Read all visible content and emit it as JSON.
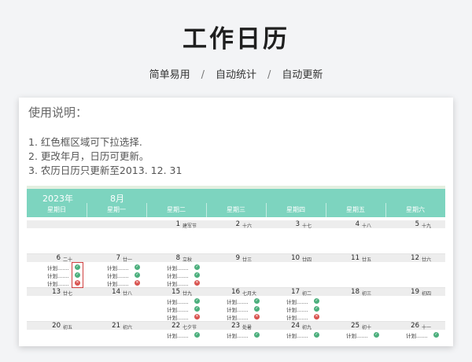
{
  "page": {
    "title": "工作日历",
    "features": [
      "简单易用",
      "自动统计",
      "自动更新"
    ],
    "separator": "/"
  },
  "instructions": {
    "title": "使用说明：",
    "items": [
      "1. 红色框区域可下拉选择.",
      "2. 更改年月，日历可更新。",
      "3. 农历日历只更新至2013. 12. 31"
    ]
  },
  "calendar": {
    "year": "2023年",
    "month": "8月",
    "weekdays": [
      "星期日",
      "星期一",
      "星期二",
      "星期三",
      "星期四",
      "星期五",
      "星期六"
    ],
    "colors": {
      "header": "#7dd4bf",
      "done": "#4caf7d",
      "not_done": "#d9534f",
      "dropdown_border": "#d04040"
    },
    "weeks": [
      {
        "days": [
          {
            "num": "",
            "lunar": "",
            "plans": []
          },
          {
            "num": "",
            "lunar": "",
            "plans": []
          },
          {
            "num": "1",
            "lunar": "建军节",
            "plans": []
          },
          {
            "num": "2",
            "lunar": "十六",
            "plans": []
          },
          {
            "num": "3",
            "lunar": "十七",
            "plans": []
          },
          {
            "num": "4",
            "lunar": "十八",
            "plans": []
          },
          {
            "num": "5",
            "lunar": "十九",
            "plans": []
          }
        ]
      },
      {
        "days": [
          {
            "num": "6",
            "lunar": "二十",
            "plans": [
              {
                "text": "计划.......",
                "status": "done"
              },
              {
                "text": "计划.......",
                "status": "done"
              },
              {
                "text": "计划.......",
                "status": "not_done"
              }
            ]
          },
          {
            "num": "7",
            "lunar": "廿一",
            "plans": [
              {
                "text": "计划.......",
                "status": "done"
              },
              {
                "text": "计划.......",
                "status": "done"
              },
              {
                "text": "计划.......",
                "status": "not_done"
              }
            ]
          },
          {
            "num": "8",
            "lunar": "立秋",
            "plans": [
              {
                "text": "计划.......",
                "status": "done"
              },
              {
                "text": "计划.......",
                "status": "done"
              },
              {
                "text": "计划.......",
                "status": "not_done"
              }
            ]
          },
          {
            "num": "9",
            "lunar": "廿三",
            "plans": []
          },
          {
            "num": "10",
            "lunar": "廿四",
            "plans": []
          },
          {
            "num": "11",
            "lunar": "廿五",
            "plans": []
          },
          {
            "num": "12",
            "lunar": "廿六",
            "plans": []
          }
        ]
      },
      {
        "days": [
          {
            "num": "13",
            "lunar": "廿七",
            "plans": []
          },
          {
            "num": "14",
            "lunar": "廿八",
            "plans": []
          },
          {
            "num": "15",
            "lunar": "廿九",
            "plans": [
              {
                "text": "计划.......",
                "status": "done"
              },
              {
                "text": "计划.......",
                "status": "done"
              },
              {
                "text": "计划.......",
                "status": "not_done"
              }
            ]
          },
          {
            "num": "16",
            "lunar": "七月大",
            "plans": [
              {
                "text": "计划.......",
                "status": "done"
              },
              {
                "text": "计划.......",
                "status": "done"
              },
              {
                "text": "计划.......",
                "status": "not_done"
              }
            ]
          },
          {
            "num": "17",
            "lunar": "初二",
            "plans": [
              {
                "text": "计划.......",
                "status": "done"
              },
              {
                "text": "计划.......",
                "status": "done"
              },
              {
                "text": "计划.......",
                "status": "not_done"
              }
            ]
          },
          {
            "num": "18",
            "lunar": "初三",
            "plans": []
          },
          {
            "num": "19",
            "lunar": "初四",
            "plans": []
          }
        ]
      },
      {
        "days": [
          {
            "num": "20",
            "lunar": "初五",
            "plans": []
          },
          {
            "num": "21",
            "lunar": "初六",
            "plans": []
          },
          {
            "num": "22",
            "lunar": "七夕节",
            "plans": [
              {
                "text": "计划.......",
                "status": "done"
              }
            ]
          },
          {
            "num": "23",
            "lunar": "处暑",
            "plans": [
              {
                "text": "计划.......",
                "status": "done"
              }
            ]
          },
          {
            "num": "24",
            "lunar": "初九",
            "plans": [
              {
                "text": "计划.......",
                "status": "done"
              }
            ]
          },
          {
            "num": "25",
            "lunar": "初十",
            "plans": [
              {
                "text": "计划.......",
                "status": "done"
              }
            ]
          },
          {
            "num": "26",
            "lunar": "十一",
            "plans": [
              {
                "text": "计划.......",
                "status": "done"
              }
            ]
          }
        ]
      }
    ]
  }
}
